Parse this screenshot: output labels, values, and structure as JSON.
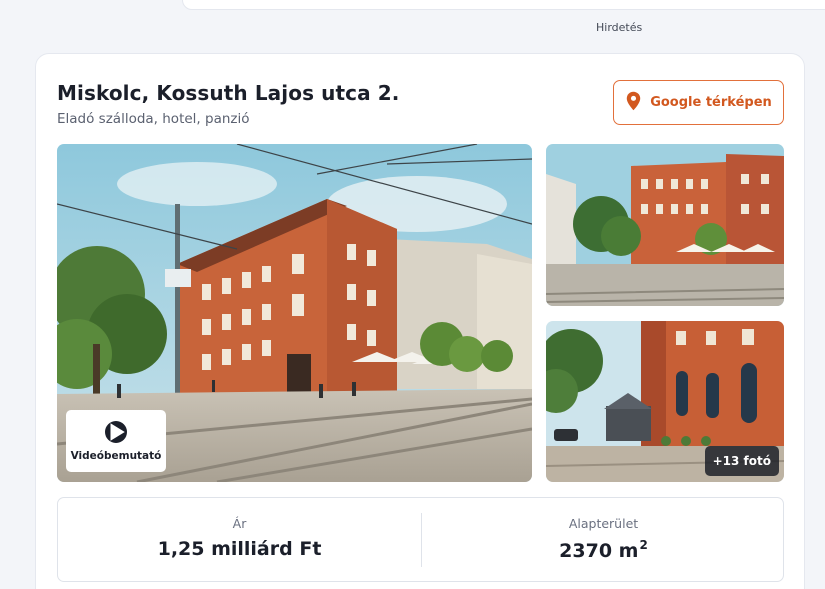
{
  "ad": {
    "label": "Hirdetés"
  },
  "listing": {
    "title": "Miskolc, Kossuth Lajos utca 2.",
    "subtitle": "Eladó szálloda, hotel, panzió",
    "map_button_label": "Google térképen",
    "video_button_label": "Videóbemutató",
    "more_photos_label": "+13 fotó",
    "price": {
      "label": "Ár",
      "value": "1,25 milliárd Ft"
    },
    "area": {
      "label": "Alapterület",
      "value": "2370 m",
      "unit_sup": "2"
    }
  },
  "colors": {
    "accent": "#d2581f",
    "accent_border": "#e2703b",
    "text_dark": "#1b1f2a",
    "text_muted": "#5b6170"
  },
  "icons": {
    "map": "map-pin-icon",
    "video": "play-icon"
  }
}
